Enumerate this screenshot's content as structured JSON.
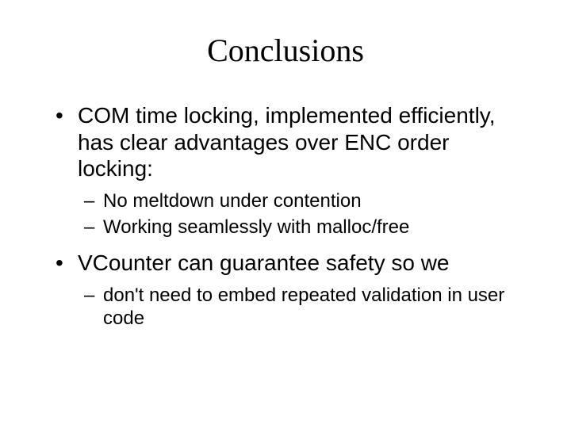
{
  "title": "Conclusions",
  "bullets": [
    {
      "text": "COM time locking, implemented efficiently, has clear advantages over ENC order locking:",
      "sub": [
        "No meltdown under contention",
        "Working seamlessly with malloc/free"
      ]
    },
    {
      "text": "VCounter can guarantee safety so we",
      "sub": [
        "don't need to embed repeated validation in user code"
      ]
    }
  ]
}
